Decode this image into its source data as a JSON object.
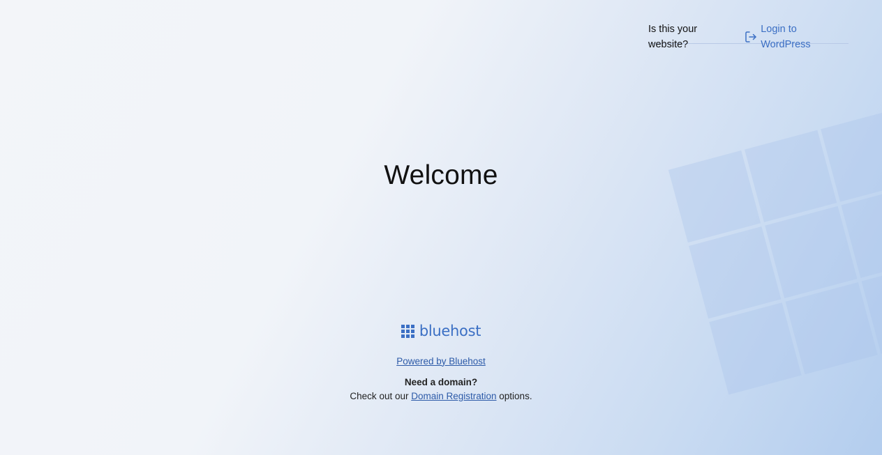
{
  "header": {
    "question": "Is this your website?",
    "login_label": "Login to WordPress",
    "login_icon": "login-icon"
  },
  "main": {
    "title": "Welcome"
  },
  "footer": {
    "brand_name": "bluehost",
    "brand_icon": "bluehost-grid-icon",
    "powered_label": "Powered by Bluehost",
    "need_domain": "Need a domain?",
    "checkout_prefix": "Check out our ",
    "domain_link": "Domain Registration",
    "checkout_suffix": " options."
  },
  "colors": {
    "accent": "#3b6fc4",
    "link": "#2c5aa8"
  }
}
